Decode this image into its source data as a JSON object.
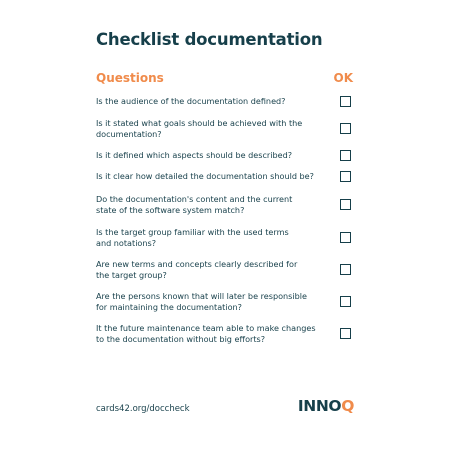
{
  "title": "Checklist documentation",
  "header": {
    "questions_label": "Questions",
    "ok_label": "OK"
  },
  "items": [
    {
      "text": "Is the audience of the documentation defined?",
      "checked": false
    },
    {
      "text": "Is it stated what goals should be achieved with the documentation?",
      "checked": false
    },
    {
      "text": "Is it defined which aspects should be described?",
      "checked": false
    },
    {
      "text": "Is it clear how detailed the documentation should be?",
      "checked": false
    },
    {
      "text": "Do the documentation's content and the current state of the software system match?",
      "checked": false
    },
    {
      "text": "Is the target group familiar with the used terms and notations?",
      "checked": false
    },
    {
      "text": "Are new terms and concepts clearly described for the target group?",
      "checked": false
    },
    {
      "text": "Are the persons known that will later be responsible for maintaining the documentation?",
      "checked": false
    },
    {
      "text": "It the future maintenance team able to make changes to the documentation without big efforts?",
      "checked": false
    }
  ],
  "footer": {
    "link": "cards42.org/doccheck"
  },
  "logo": {
    "text_main": "INNO",
    "text_accent": "Q"
  },
  "colors": {
    "primary": "#163f4a",
    "accent": "#f08b4b"
  }
}
